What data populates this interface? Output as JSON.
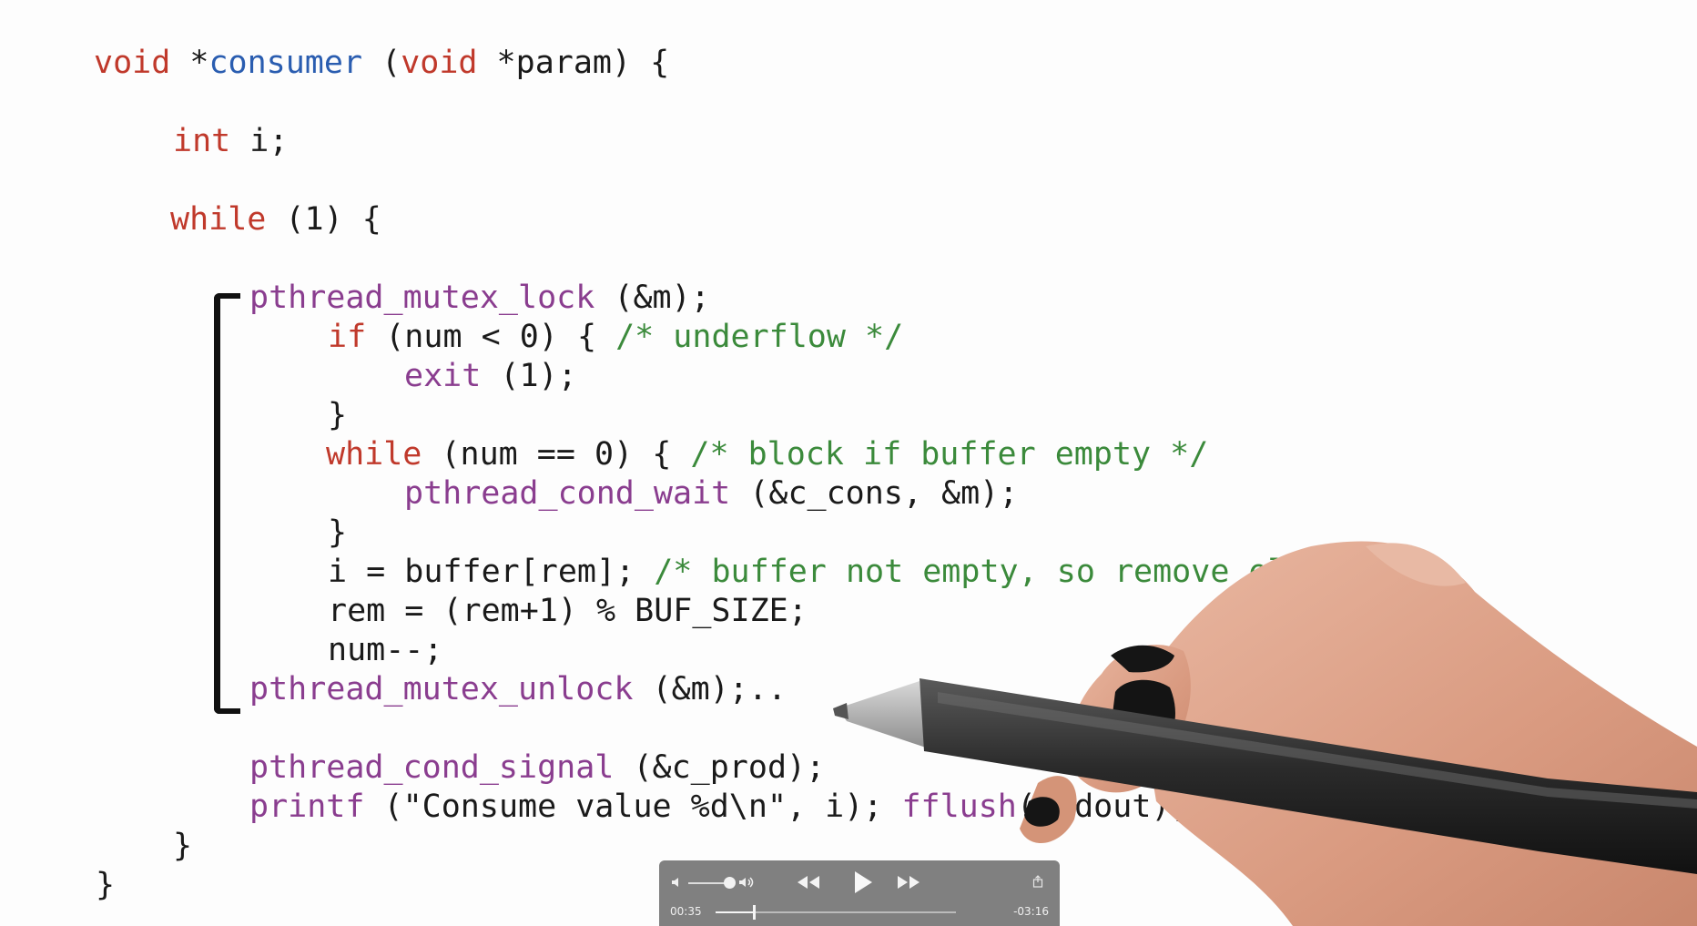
{
  "code": {
    "l1": {
      "kw1": "void",
      "p1": " *",
      "fn": "consumer",
      "p2": " (",
      "kw2": "void",
      "p3": " *param) {"
    },
    "l2": {
      "kw": "int",
      "p": " i;"
    },
    "l3": {
      "kw": "while",
      "p": " (1) {"
    },
    "l4": {
      "fn": "pthread_mutex_lock",
      "p": " (&m);"
    },
    "l5": {
      "kw": "if",
      "p": " (num < 0) { ",
      "cm": "/* underflow */"
    },
    "l6": {
      "fn": "exit",
      "p": " (1);"
    },
    "l7": {
      "p": "}"
    },
    "l8": {
      "kw": "while",
      "p": " (num == 0) { ",
      "cm": "/* block if buffer empty */"
    },
    "l9": {
      "fn": "pthread_cond_wait",
      "p": " (&c_cons, &m);"
    },
    "l10": {
      "p": "}"
    },
    "l11": {
      "p": "i = buffer[rem]; ",
      "cm": "/* buffer not empty, so remove element */"
    },
    "l12": {
      "p": "rem = (rem+1) % BUF_SIZE;"
    },
    "l13": {
      "p": "num--;"
    },
    "l14": {
      "fn": "pthread_mutex_unlock",
      "p": " (&m);.."
    },
    "l15": {
      "fn": "pthread_cond_signal",
      "p": " (&c_prod);"
    },
    "l16": {
      "fn1": "printf",
      "p1": " (\"Consume value %d\\n\", i); ",
      "fn2": "fflush",
      "p2": "(stdout);"
    },
    "l17": {
      "p": "}"
    },
    "l18": {
      "p": "}"
    }
  },
  "player": {
    "current_time": "00:35",
    "remaining_time": "-03:16",
    "progress": 0.16,
    "volume": 0.85,
    "icons": {
      "volume_low": "speaker-low-icon",
      "volume_high": "speaker-high-icon",
      "rewind": "rewind-icon",
      "play": "play-icon",
      "fast_forward": "fast-forward-icon",
      "share": "share-icon"
    }
  },
  "colors": {
    "keyword": "#c0392b",
    "function": "#8a3d8f",
    "comment": "#3b8a3b",
    "plain": "#1a1a1a",
    "identifier": "#2a5db0",
    "player_bg": "#646464"
  }
}
